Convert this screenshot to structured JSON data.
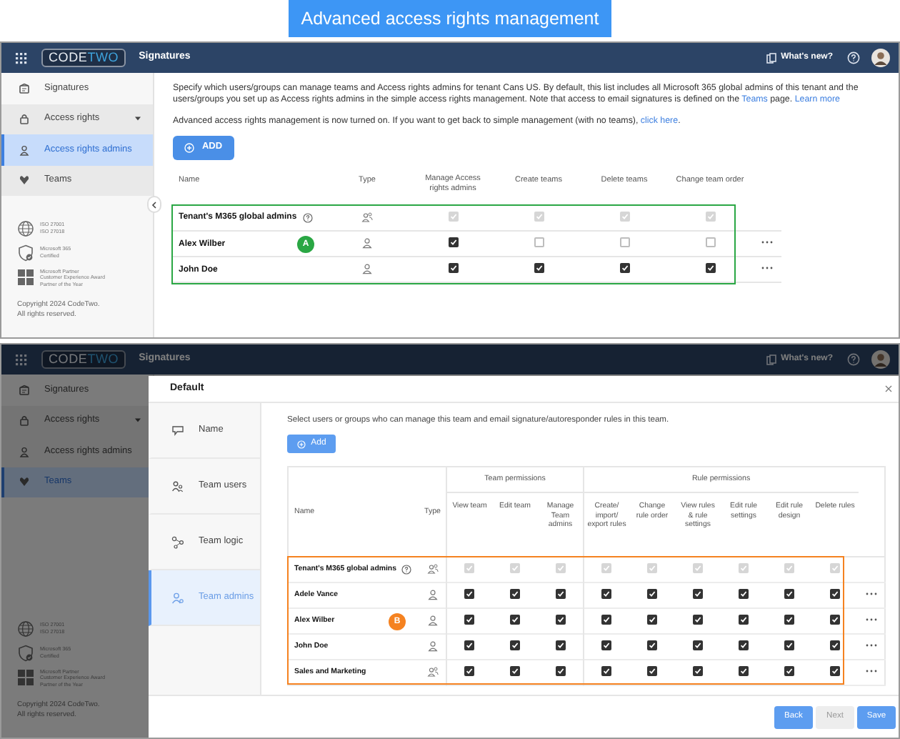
{
  "banner": {
    "title": "Advanced access rights management"
  },
  "top_screen": {
    "header": {
      "logo": [
        "CODE",
        "TWO"
      ],
      "app_name": "Signatures",
      "whats_new": "What's new?"
    },
    "sidebar": {
      "items": [
        {
          "label": "Signatures",
          "kind": "link",
          "selected": false
        },
        {
          "label": "Access rights",
          "kind": "section",
          "selected": false
        },
        {
          "label": "Access rights admins",
          "kind": "link",
          "selected": true
        },
        {
          "label": "Teams",
          "kind": "link",
          "selected": false
        }
      ],
      "badges": [
        {
          "lines": [
            "ISO 27001",
            "ISO 27018"
          ]
        },
        {
          "lines": [
            "Microsoft 365",
            "Certified"
          ]
        },
        {
          "lines": [
            "Microsoft Partner",
            "Customer Experience Award",
            "Partner of the Year"
          ]
        }
      ],
      "copyright": [
        "Copyright 2024 CodeTwo.",
        "All rights reserved."
      ]
    },
    "description": [
      {
        "kind": "text",
        "text": "Specify which users/groups can manage teams and Access rights admins for tenant Cans US. By default, this list includes all Microsoft 365 global admins of this tenant and the users/groups you set up as Access rights admins in the simple access rights management. Note that access to email signatures is defined on the "
      },
      {
        "kind": "link",
        "text": "Teams"
      },
      {
        "kind": "text",
        "text": " page. "
      },
      {
        "kind": "link",
        "text": "Learn more"
      }
    ],
    "notice": [
      {
        "kind": "text",
        "text": "Advanced access rights management is now turned on. If you want to get back to simple management (with no teams), "
      },
      {
        "kind": "link",
        "text": "click here"
      },
      {
        "kind": "text",
        "text": "."
      }
    ],
    "add_button": "ADD",
    "table": {
      "columns": [
        "Name",
        "Type",
        "Manage Access rights admins",
        "Create teams",
        "Delete teams",
        "Change team order"
      ],
      "rows": [
        {
          "name": "Tenant's M365 global admins",
          "kind": "group",
          "help": true,
          "menu": false,
          "cells": [
            {
              "checked": true,
              "disabled": true
            },
            {
              "checked": true,
              "disabled": true
            },
            {
              "checked": true,
              "disabled": true
            },
            {
              "checked": true,
              "disabled": true
            }
          ]
        },
        {
          "name": "Alex Wilber",
          "kind": "user",
          "help": false,
          "menu": true,
          "marker": "A",
          "cells": [
            {
              "checked": true,
              "disabled": false
            },
            {
              "checked": false,
              "disabled": false
            },
            {
              "checked": false,
              "disabled": false
            },
            {
              "checked": false,
              "disabled": false
            }
          ]
        },
        {
          "name": "John Doe",
          "kind": "user",
          "help": false,
          "menu": true,
          "cells": [
            {
              "checked": true,
              "disabled": false
            },
            {
              "checked": true,
              "disabled": false
            },
            {
              "checked": true,
              "disabled": false
            },
            {
              "checked": true,
              "disabled": false
            }
          ]
        }
      ]
    }
  },
  "bottom_screen": {
    "header": {
      "logo": [
        "CODE",
        "TWO"
      ],
      "app_name": "Signatures",
      "whats_new": "What's new?"
    },
    "sidebar": {
      "items": [
        {
          "label": "Signatures",
          "kind": "link",
          "selected": false
        },
        {
          "label": "Access rights",
          "kind": "section",
          "selected": false
        },
        {
          "label": "Access rights admins",
          "kind": "link",
          "selected": false
        },
        {
          "label": "Teams",
          "kind": "link",
          "selected": true
        }
      ],
      "badges": [
        {
          "lines": [
            "ISO 27001",
            "ISO 27018"
          ]
        },
        {
          "lines": [
            "Microsoft 365",
            "Certified"
          ]
        },
        {
          "lines": [
            "Microsoft Partner",
            "Customer Experience Award",
            "Partner of the Year"
          ]
        }
      ],
      "copyright": [
        "Copyright 2024 CodeTwo.",
        "All rights reserved."
      ]
    },
    "dialog": {
      "title": "Default",
      "nav": [
        {
          "label": "Name",
          "selected": false
        },
        {
          "label": "Team users",
          "selected": false
        },
        {
          "label": "Team logic",
          "selected": false
        },
        {
          "label": "Team admins",
          "selected": true
        }
      ],
      "description": "Select users or groups who can manage this team and email signature/autoresponder rules in this team.",
      "add_button": "Add",
      "table": {
        "name_column": "Name",
        "type_column": "Type",
        "groups": [
          {
            "label": "Team permissions",
            "columns": [
              "View team",
              "Edit team",
              "Manage Team admins"
            ]
          },
          {
            "label": "Rule permissions",
            "columns": [
              "Create/ import/ export rules",
              "Change rule order",
              "View rules & rule settings",
              "Edit rule settings",
              "Edit rule design",
              "Delete rules"
            ]
          }
        ],
        "rows": [
          {
            "name": "Tenant's M365 global admins",
            "kind": "group",
            "help": true,
            "menu": false,
            "cells": [
              {
                "checked": true,
                "disabled": true
              },
              {
                "checked": true,
                "disabled": true
              },
              {
                "checked": true,
                "disabled": true
              },
              {
                "checked": true,
                "disabled": true
              },
              {
                "checked": true,
                "disabled": true
              },
              {
                "checked": true,
                "disabled": true
              },
              {
                "checked": true,
                "disabled": true
              },
              {
                "checked": true,
                "disabled": true
              },
              {
                "checked": true,
                "disabled": true
              }
            ]
          },
          {
            "name": "Adele Vance",
            "kind": "user",
            "help": false,
            "menu": true,
            "cells": [
              {
                "checked": true,
                "disabled": false
              },
              {
                "checked": true,
                "disabled": false
              },
              {
                "checked": true,
                "disabled": false
              },
              {
                "checked": true,
                "disabled": false
              },
              {
                "checked": true,
                "disabled": false
              },
              {
                "checked": true,
                "disabled": false
              },
              {
                "checked": true,
                "disabled": false
              },
              {
                "checked": true,
                "disabled": false
              },
              {
                "checked": true,
                "disabled": false
              }
            ]
          },
          {
            "name": "Alex Wilber",
            "kind": "user",
            "help": false,
            "menu": true,
            "marker": "B",
            "cells": [
              {
                "checked": true,
                "disabled": false
              },
              {
                "checked": true,
                "disabled": false
              },
              {
                "checked": true,
                "disabled": false
              },
              {
                "checked": true,
                "disabled": false
              },
              {
                "checked": true,
                "disabled": false
              },
              {
                "checked": true,
                "disabled": false
              },
              {
                "checked": true,
                "disabled": false
              },
              {
                "checked": true,
                "disabled": false
              },
              {
                "checked": true,
                "disabled": false
              }
            ]
          },
          {
            "name": "John Doe",
            "kind": "user",
            "help": false,
            "menu": true,
            "cells": [
              {
                "checked": true,
                "disabled": false
              },
              {
                "checked": true,
                "disabled": false
              },
              {
                "checked": true,
                "disabled": false
              },
              {
                "checked": true,
                "disabled": false
              },
              {
                "checked": true,
                "disabled": false
              },
              {
                "checked": true,
                "disabled": false
              },
              {
                "checked": true,
                "disabled": false
              },
              {
                "checked": true,
                "disabled": false
              },
              {
                "checked": true,
                "disabled": false
              }
            ]
          },
          {
            "name": "Sales and Marketing",
            "kind": "group",
            "help": false,
            "menu": true,
            "cells": [
              {
                "checked": true,
                "disabled": false
              },
              {
                "checked": true,
                "disabled": false
              },
              {
                "checked": true,
                "disabled": false
              },
              {
                "checked": true,
                "disabled": false
              },
              {
                "checked": true,
                "disabled": false
              },
              {
                "checked": true,
                "disabled": false
              },
              {
                "checked": true,
                "disabled": false
              },
              {
                "checked": true,
                "disabled": false
              },
              {
                "checked": true,
                "disabled": false
              }
            ]
          }
        ]
      },
      "buttons": [
        {
          "label": "Back",
          "disabled": false
        },
        {
          "label": "Next",
          "disabled": true
        },
        {
          "label": "Save",
          "disabled": false
        }
      ]
    }
  }
}
